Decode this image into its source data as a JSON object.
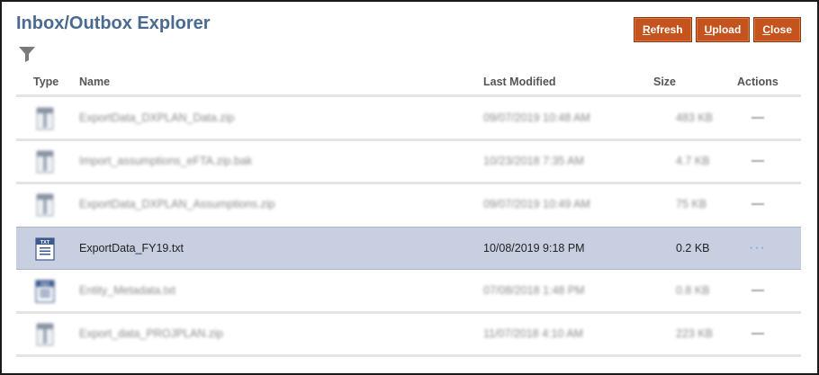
{
  "window": {
    "title": "Inbox/Outbox Explorer"
  },
  "toolbar": {
    "refresh": {
      "accel": "R",
      "rest": "efresh"
    },
    "upload": {
      "accel": "U",
      "rest": "pload"
    },
    "close": {
      "accel": "C",
      "rest": "lose"
    }
  },
  "table": {
    "columns": {
      "type": "Type",
      "name": "Name",
      "modified": "Last Modified",
      "size": "Size",
      "actions": "Actions"
    },
    "rows": [
      {
        "name": "ExportData_DXPLAN_Data.zip",
        "modified": "09/07/2019 10:48 AM",
        "size": "483 KB",
        "icon": "zip-icon",
        "blurred": true
      },
      {
        "name": "Import_assumptions_eFTA.zip.bak",
        "modified": "10/23/2018 7:35 AM",
        "size": "4.7 KB",
        "icon": "zip-icon",
        "blurred": true
      },
      {
        "name": "ExportData_DXPLAN_Assumptions.zip",
        "modified": "09/07/2019 10:49 AM",
        "size": "75 KB",
        "icon": "zip-icon",
        "blurred": true
      },
      {
        "name": "ExportData_FY19.txt",
        "modified": "10/08/2019 9:18 PM",
        "size": "0.2 KB",
        "icon": "txt-file-icon",
        "blurred": false,
        "selected": true,
        "actions": "···"
      },
      {
        "name": "Entity_Metadata.txt",
        "modified": "07/08/2018 1:48 PM",
        "size": "0.8 KB",
        "icon": "txt-file-icon",
        "blurred": true
      },
      {
        "name": "Export_data_PROJPLAN.zip",
        "modified": "11/07/2018 4:10 AM",
        "size": "223 KB",
        "icon": "zip-icon",
        "blurred": true
      }
    ]
  },
  "colors": {
    "accent_button": "#c5531e",
    "title": "#4a6b8f",
    "selected_row": "#c7cfe0"
  }
}
